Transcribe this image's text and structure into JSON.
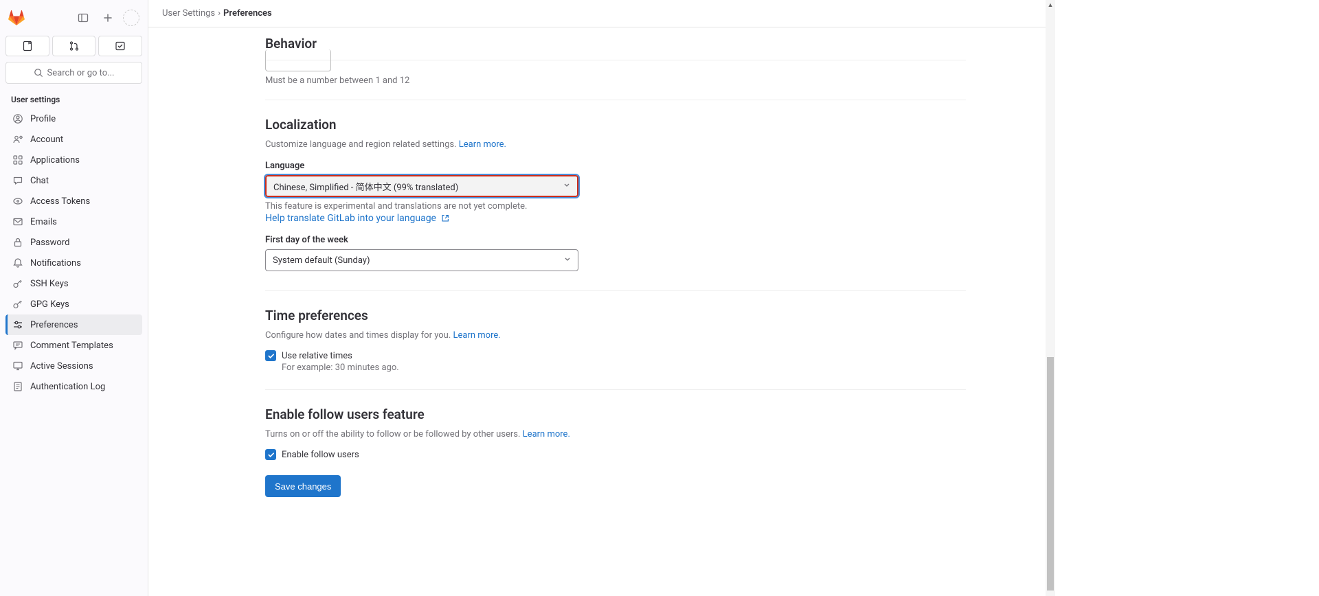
{
  "search_placeholder": "Search or go to...",
  "sidebar_label": "User settings",
  "nav": [
    {
      "id": "profile",
      "label": "Profile"
    },
    {
      "id": "account",
      "label": "Account"
    },
    {
      "id": "applications",
      "label": "Applications"
    },
    {
      "id": "chat",
      "label": "Chat"
    },
    {
      "id": "access-tokens",
      "label": "Access Tokens"
    },
    {
      "id": "emails",
      "label": "Emails"
    },
    {
      "id": "password",
      "label": "Password"
    },
    {
      "id": "notifications",
      "label": "Notifications"
    },
    {
      "id": "ssh-keys",
      "label": "SSH Keys"
    },
    {
      "id": "gpg-keys",
      "label": "GPG Keys"
    },
    {
      "id": "preferences",
      "label": "Preferences"
    },
    {
      "id": "comment-templates",
      "label": "Comment Templates"
    },
    {
      "id": "active-sessions",
      "label": "Active Sessions"
    },
    {
      "id": "auth-log",
      "label": "Authentication Log"
    }
  ],
  "breadcrumb": {
    "parent": "User Settings",
    "sep": "›",
    "current": "Preferences"
  },
  "behavior": {
    "title": "Behavior",
    "helper": "Must be a number between 1 and 12"
  },
  "localization": {
    "title": "Localization",
    "desc": "Customize language and region related settings. ",
    "learn_more": "Learn more.",
    "language_label": "Language",
    "language_value": "Chinese, Simplified - 简体中文 (99% translated)",
    "experimental": "This feature is experimental and translations are not yet complete.",
    "help_translate": "Help translate GitLab into your language",
    "first_day_label": "First day of the week",
    "first_day_value": "System default (Sunday)"
  },
  "time_prefs": {
    "title": "Time preferences",
    "desc": "Configure how dates and times display for you. ",
    "learn_more": "Learn more.",
    "checkbox_label": "Use relative times",
    "checkbox_help": "For example: 30 minutes ago."
  },
  "follow": {
    "title": "Enable follow users feature",
    "desc": "Turns on or off the ability to follow or be followed by other users. ",
    "learn_more": "Learn more.",
    "checkbox_label": "Enable follow users"
  },
  "save_label": "Save changes"
}
